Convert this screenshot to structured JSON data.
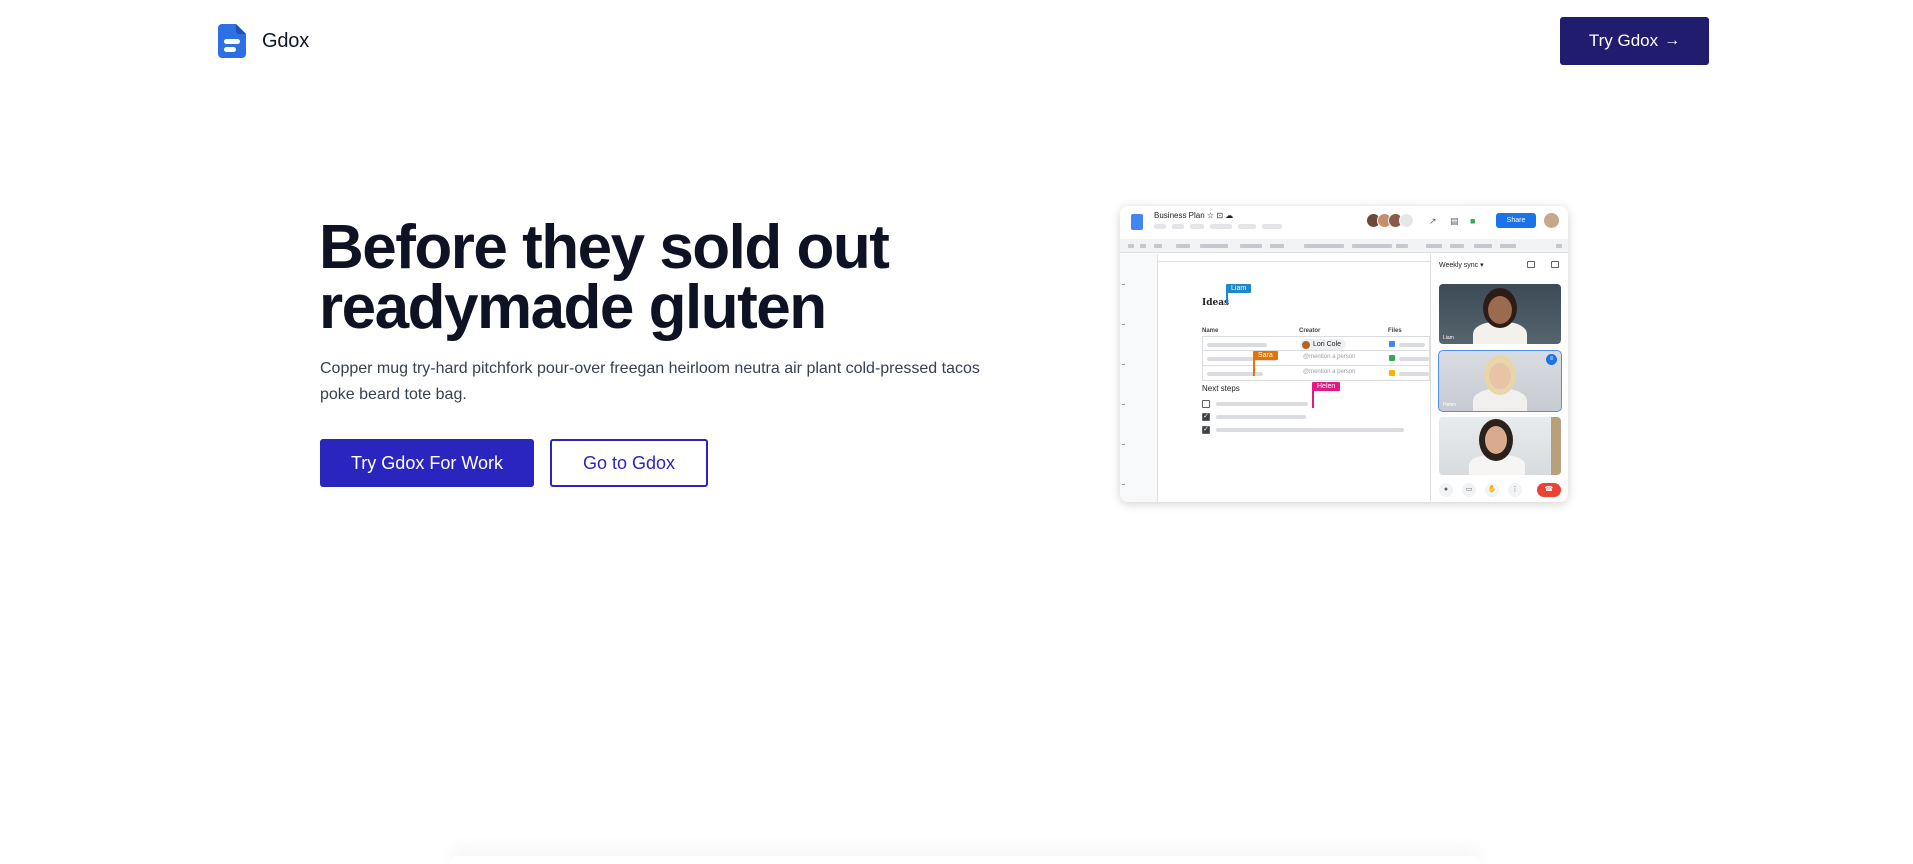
{
  "header": {
    "brand": "Gdox",
    "cta_label": "Try Gdox",
    "cta_arrow": "→"
  },
  "hero": {
    "title_line1": "Before they sold out",
    "title_line2": "readymade gluten",
    "subtitle": "Copper mug try-hard pitchfork pour-over freegan heirloom neutra air plant cold-pressed tacos poke beard tote bag.",
    "primary_button": "Try Gdox For Work",
    "secondary_button": "Go to Gdox"
  },
  "mockup": {
    "doc_title": "Business Plan ☆ ⊡ ☁",
    "share_label": "Share",
    "heading": "Ideas",
    "flags": {
      "liam": "Liam",
      "sara": "Sara",
      "helen": "Helen"
    },
    "table_headers": [
      "Name",
      "Creator",
      "Files"
    ],
    "creator_chip": "Lori Cole",
    "mention_placeholder": "@mention a person",
    "next_steps": "Next steps",
    "meeting_title": "Weekly sync ▾",
    "video_names": [
      "Liam",
      "Helen"
    ],
    "colors": {
      "liam_flag": "#1e88c9",
      "sara_flag": "#e37400",
      "helen_flag": "#e01b84",
      "share": "#1a73e8",
      "hangup": "#ea4335"
    }
  },
  "colors": {
    "primary": "#2b25c0",
    "navy": "#201c6e",
    "title": "#0f1222"
  }
}
